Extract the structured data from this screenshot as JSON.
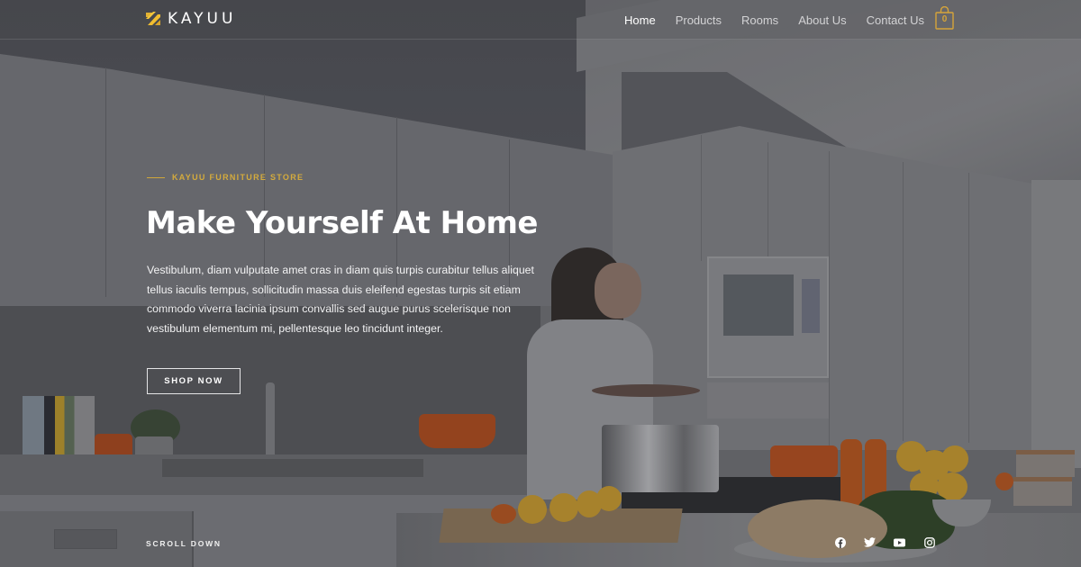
{
  "brand": {
    "name": "KAYUU",
    "logo_icon": "kayuu-logo-icon",
    "accent_color": "#d4ab3d"
  },
  "nav": {
    "items": [
      {
        "label": "Home",
        "active": true
      },
      {
        "label": "Products",
        "active": false
      },
      {
        "label": "Rooms",
        "active": false
      },
      {
        "label": "About Us",
        "active": false
      },
      {
        "label": "Contact Us",
        "active": false
      }
    ],
    "cart": {
      "icon": "shopping-bag-icon",
      "count": "0"
    }
  },
  "hero": {
    "eyebrow": "KAYUU FURNITURE STORE",
    "title": "Make Yourself At Home",
    "description": "Vestibulum, diam vulputate amet cras in diam quis turpis curabitur tellus aliquet tellus iaculis tempus, sollicitudin massa duis eleifend egestas turpis sit etiam commodo viverra lacinia ipsum convallis sed augue purus scelerisque non vestibulum elementum mi, pellentesque leo tincidunt integer.",
    "cta_label": "SHOP NOW",
    "background": "kitchen-photo"
  },
  "footer": {
    "scroll_label": "SCROLL DOWN",
    "social": [
      {
        "name": "facebook",
        "icon": "facebook-icon"
      },
      {
        "name": "twitter",
        "icon": "twitter-icon"
      },
      {
        "name": "youtube",
        "icon": "youtube-icon"
      },
      {
        "name": "instagram",
        "icon": "instagram-icon"
      }
    ]
  }
}
